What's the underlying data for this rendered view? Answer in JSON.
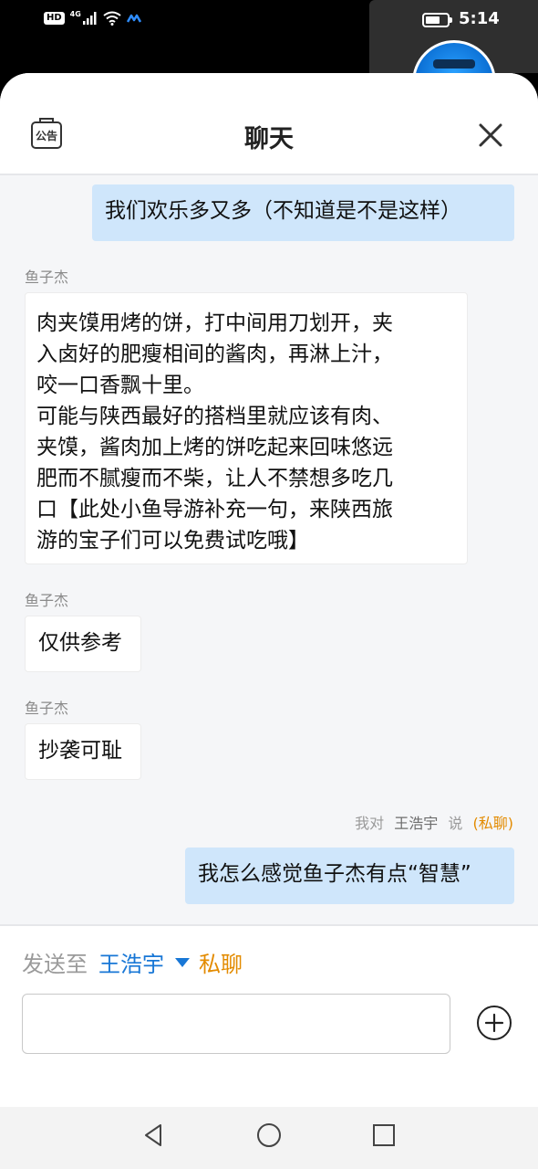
{
  "status_bar": {
    "hd": "HD",
    "network": "4G",
    "time": "5:14",
    "battery_level": 0.7
  },
  "header": {
    "notice_label": "公告",
    "title": "聊天"
  },
  "messages": [
    {
      "type": "right",
      "text": "我们欢乐多又多（不知道是不是这样）"
    },
    {
      "type": "left",
      "sender": "鱼子杰",
      "lines": [
        "肉夹馍用烤的饼，打中间用刀划开，夹",
        "入卤好的肥瘦相间的酱肉，再淋上汁，",
        "咬一口香飘十里。",
        "可能与陕西最好的搭档里就应该有肉、",
        "夹馍，酱肉加上烤的饼吃起来回味悠远",
        "肥而不腻瘦而不柴，让人不禁想多吃几",
        "口【此处小鱼导游补充一句，来陕西旅",
        "游的宝子们可以免费试吃哦】"
      ]
    },
    {
      "type": "left",
      "sender": "鱼子杰",
      "text": "仅供参考"
    },
    {
      "type": "left",
      "sender": "鱼子杰",
      "text": "抄袭可耻"
    },
    {
      "type": "right",
      "private_prefix": "我对",
      "private_target": "王浩宇",
      "private_say": "说",
      "private_tag": "(私聊)",
      "text": "我怎么感觉鱼子杰有点“智慧”"
    }
  ],
  "composer": {
    "send_to_label": "发送至",
    "recipient": "王浩宇",
    "mode": "私聊",
    "input_value": ""
  },
  "colors": {
    "accent_blue": "#1877d6",
    "private_orange": "#e38b00",
    "bubble_self": "#cfe6fb"
  }
}
